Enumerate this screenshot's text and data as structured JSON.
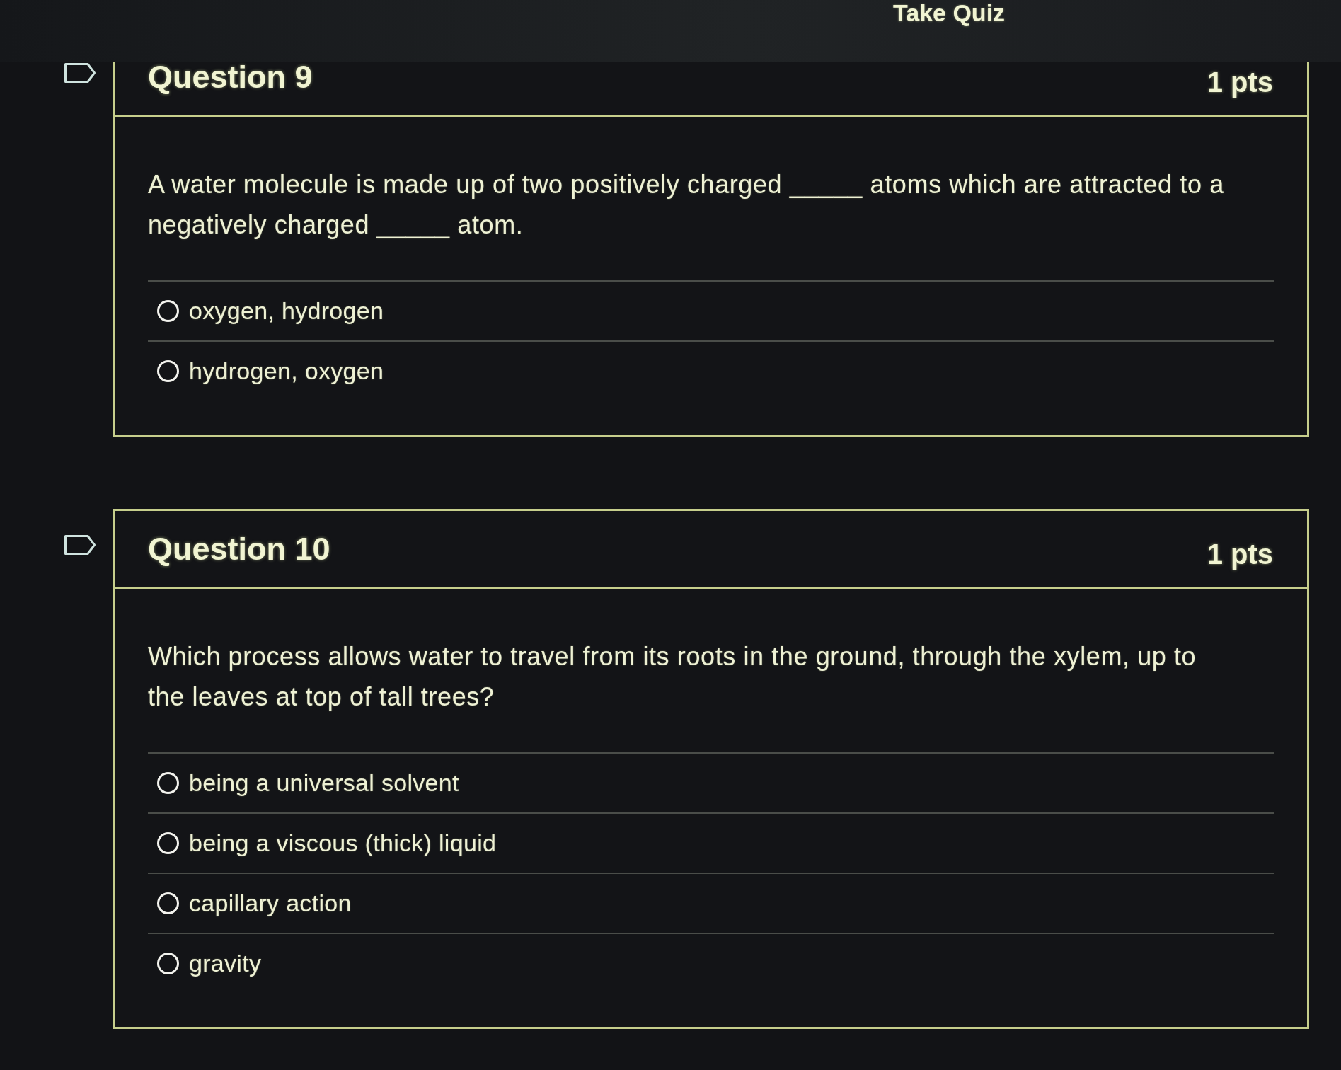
{
  "header": {
    "title": "Take Quiz"
  },
  "questions": [
    {
      "title": "Question 9",
      "points": "1 pts",
      "flagged": false,
      "text": "A water molecule is made up of two positively charged _____ atoms which are attracted to a negatively charged _____ atom.",
      "answers": [
        {
          "label": "oxygen, hydrogen",
          "selected": false
        },
        {
          "label": "hydrogen, oxygen",
          "selected": false
        }
      ]
    },
    {
      "title": "Question 10",
      "points": "1 pts",
      "flagged": false,
      "text": "Which process allows water to travel from its roots in the ground, through the xylem, up to the leaves at top of tall trees?",
      "answers": [
        {
          "label": "being a universal solvent",
          "selected": false
        },
        {
          "label": "being a viscous (thick) liquid",
          "selected": false
        },
        {
          "label": "capillary action",
          "selected": false
        },
        {
          "label": "gravity",
          "selected": false
        }
      ]
    }
  ]
}
